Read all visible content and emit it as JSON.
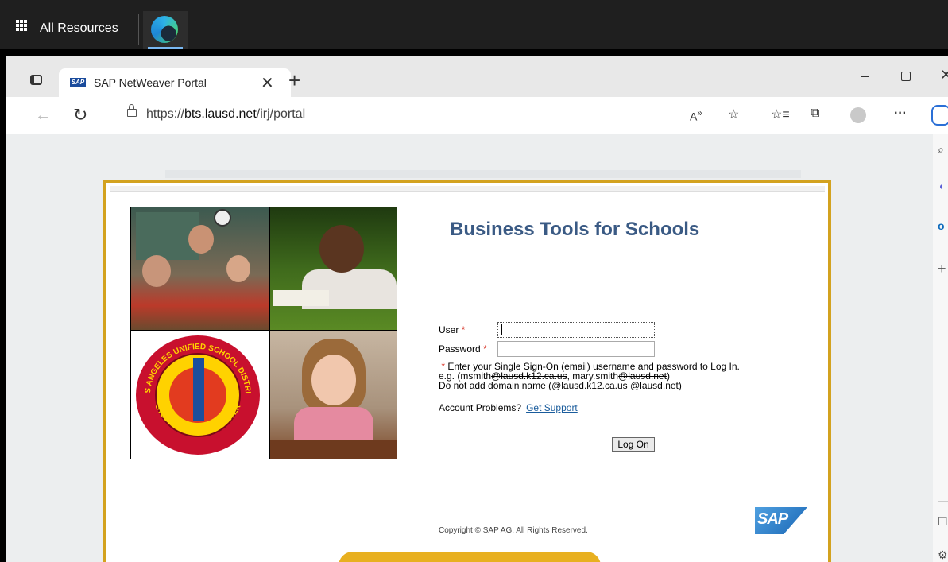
{
  "remote_desktop": {
    "title": "All Resources",
    "app_icon": "edge-icon"
  },
  "browser": {
    "tab": {
      "title": "SAP NetWeaver Portal",
      "favicon_text": "SAP"
    },
    "url": {
      "prefix": "https://",
      "host": "bts.lausd.net",
      "path": "/irj/portal"
    },
    "icons": [
      "back-icon",
      "reload-icon",
      "lock-icon",
      "read-aloud-icon",
      "add-favorite-icon",
      "favorites-icon",
      "collections-icon",
      "profile-icon",
      "more-icon",
      "copilot-icon"
    ],
    "window_controls": {
      "minimize": "—",
      "maximize": "☐",
      "close": "✕"
    }
  },
  "sidebar": {
    "icons": [
      "search-icon",
      "copilot-icon",
      "outlook-icon",
      "add-icon",
      "window-icon",
      "settings-icon"
    ]
  },
  "portal": {
    "title": "Business Tools for Schools",
    "user_label": "User",
    "password_label": "Password",
    "required_mark": "*",
    "hint_line1": "Enter your Single Sign-On (email) username and password to Log In.",
    "hint_line2_a": "e.g. (msmith",
    "hint_line2_b": "@lausd.k12.ca.us",
    "hint_line2_c": ", mary.smith",
    "hint_line2_d": "@lausd.net",
    "hint_line2_e": ")",
    "hint_line3": "Do not add domain name (@lausd.k12.ca.us @lausd.net)",
    "account_text": "Account Problems?",
    "support_link": "Get Support",
    "logon_button": "Log On",
    "copyright": "Copyright © SAP AG. All Rights Reserved.",
    "sap_logo_text": "SAP",
    "seal_top_text": "LOS ANGELES UNIFIED SCHOOL DISTRICT",
    "seal_bottom_text": "STUDENTS AT THE CENTER"
  },
  "colors": {
    "frame_gold": "#d3a21f",
    "title_blue": "#3a5a84",
    "link_blue": "#1a5c9c",
    "required_red": "#d52b1e"
  }
}
